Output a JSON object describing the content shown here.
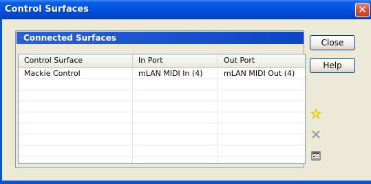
{
  "window": {
    "title": "Control Surfaces",
    "close_glyph": "✕"
  },
  "group": {
    "header": "Connected Surfaces"
  },
  "table": {
    "columns": [
      "Control Surface",
      "In Port",
      "Out Port"
    ],
    "rows": [
      [
        "Mackie Control",
        "mLAN MIDI In (4)",
        "mLAN MIDI Out (4)"
      ]
    ]
  },
  "buttons": {
    "close_label": "Close",
    "help_label": "Help"
  },
  "icons": {
    "add": "star-icon",
    "delete": "x-icon",
    "properties": "properties-icon"
  },
  "colors": {
    "titlebar": "#0054e3",
    "header": "#0b45c8",
    "face": "#ece9d8"
  }
}
